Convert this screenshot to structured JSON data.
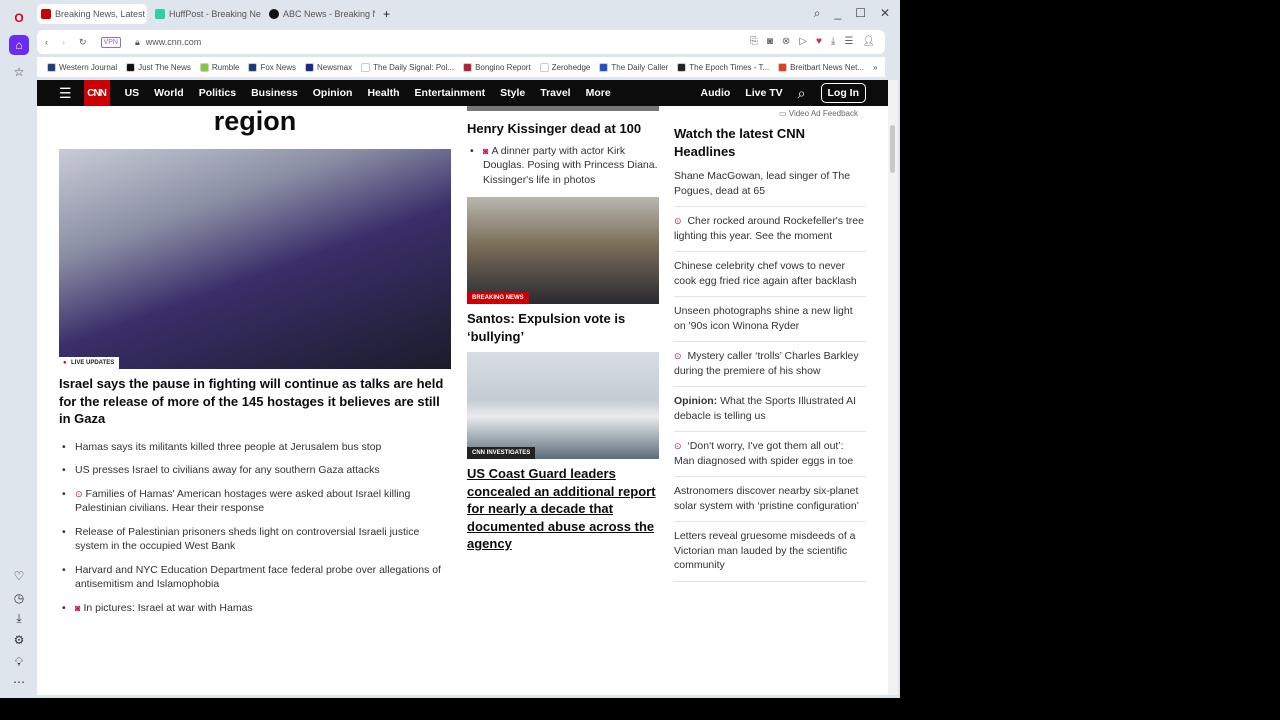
{
  "browser": {
    "tabs": [
      {
        "title": "Breaking News, Latest Ne",
        "color": "#cc0000"
      },
      {
        "title": "HuffPost - Breaking News",
        "color": "#2bd1a5"
      },
      {
        "title": "ABC News - Breaking Nev",
        "color": "#111111"
      }
    ],
    "new_tab": "+",
    "url": "www.cnn.com",
    "vpn": "VPN",
    "bookmarks": [
      {
        "label": "Western Journal",
        "color": "#1d3f7a"
      },
      {
        "label": "Just The News",
        "color": "#111"
      },
      {
        "label": "Rumble",
        "color": "#85c742"
      },
      {
        "label": "Fox News",
        "color": "#1b3b7a"
      },
      {
        "label": "Newsmax",
        "color": "#1b2a8f"
      },
      {
        "label": "The Daily Signal: Pol...",
        "color": "#fff"
      },
      {
        "label": "Bongino Report",
        "color": "#b22234"
      },
      {
        "label": "Zerohedge",
        "color": "#fff"
      },
      {
        "label": "The Daily Caller",
        "color": "#1e4fcf"
      },
      {
        "label": "The Epoch Times - T...",
        "color": "#222"
      },
      {
        "label": "Breitbart News Net...",
        "color": "#e0401c"
      }
    ],
    "bookmarks_more": "»"
  },
  "nav": {
    "logo": "CNN",
    "items": [
      "US",
      "World",
      "Politics",
      "Business",
      "Opinion",
      "Health",
      "Entertainment",
      "Style",
      "Travel",
      "More"
    ],
    "right": [
      "Audio",
      "Live TV"
    ],
    "login": "Log In"
  },
  "left": {
    "region_title": "region",
    "label": "LIVE UPDATES",
    "headline": "Israel says the pause in fighting will continue as talks are held for the release of more of the 145 hostages it believes are still in Gaza",
    "bullets": [
      {
        "text": "Hamas says its militants killed three people at Jerusalem bus stop",
        "icon": ""
      },
      {
        "text": "US presses Israel to civilians away for any southern Gaza attacks",
        "icon": ""
      },
      {
        "text": "Families of Hamas' American hostages were asked about Israel killing Palestinian civilians. Hear their response",
        "icon": "video"
      },
      {
        "text": "Release of Palestinian prisoners sheds light on controversial Israeli justice system in the occupied West Bank",
        "icon": ""
      },
      {
        "text": "Harvard and NYC Education Department face federal probe over allegations of antisemitism and Islamophobia",
        "icon": ""
      },
      {
        "text": "In pictures: Israel at war with Hamas",
        "icon": "camera"
      }
    ]
  },
  "middle": {
    "kissinger": "Henry Kissinger dead at 100",
    "kissinger_sub": "A dinner party with actor Kirk Douglas. Posing with Princess Diana. Kissinger's life in photos",
    "label1": "BREAKING NEWS",
    "santos": "Santos: Expulsion vote is ‘bullying’",
    "label2": "CNN INVESTIGATES",
    "coast": "US Coast Guard leaders concealed an additional report for nearly a decade that documented abuse across the agency"
  },
  "right": {
    "ad_feedback": "Video Ad Feedback",
    "title": "Watch the latest CNN Headlines",
    "items": [
      {
        "text": "Shane MacGowan, lead singer of The Pogues, dead at 65",
        "video": false
      },
      {
        "text": "Cher rocked around Rockefeller's tree lighting this year. See the moment",
        "video": true
      },
      {
        "text": "Chinese celebrity chef vows to never cook egg fried rice again after backlash",
        "video": false
      },
      {
        "text": "Unseen photographs shine a new light on '90s icon Winona Ryder",
        "video": false
      },
      {
        "text": "Mystery caller ‘trolls’ Charles Barkley during the premiere of his show",
        "video": true
      },
      {
        "prefix": "Opinion:",
        "text": " What the Sports Illustrated AI debacle is telling us",
        "video": false
      },
      {
        "text": "‘Don't worry, I've got them all out’: Man diagnosed with spider eggs in toe",
        "video": true
      },
      {
        "text": "Astronomers discover nearby six-planet solar system with ‘pristine configuration’",
        "video": false
      },
      {
        "text": "Letters reveal gruesome misdeeds of a Victorian man lauded by the scientific community",
        "video": false
      }
    ]
  }
}
